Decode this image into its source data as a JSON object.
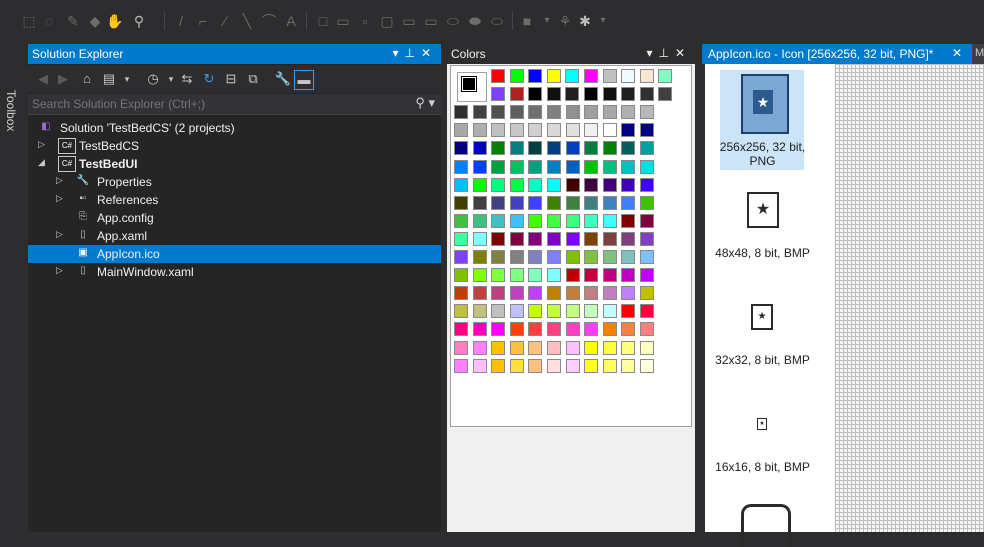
{
  "toolbox": {
    "label": "Toolbox"
  },
  "solution_explorer": {
    "title": "Solution Explorer",
    "search_placeholder": "Search Solution Explorer (Ctrl+;)",
    "items": [
      {
        "label": "Solution 'TestBedCS' (2 projects)"
      },
      {
        "label": "TestBedCS"
      },
      {
        "label": "TestBedUI"
      },
      {
        "label": "Properties"
      },
      {
        "label": "References"
      },
      {
        "label": "App.config"
      },
      {
        "label": "App.xaml"
      },
      {
        "label": "AppIcon.ico"
      },
      {
        "label": "MainWindow.xaml"
      }
    ]
  },
  "colors_panel": {
    "title": "Colors"
  },
  "editor": {
    "tab_title": "AppIcon.ico - Icon [256x256, 32 bit, PNG]*",
    "tab2_label": "M",
    "thumbnails": [
      {
        "label_line1": "256x256, 32 bit,",
        "label_line2": "PNG"
      },
      {
        "label": "48x48, 8 bit, BMP"
      },
      {
        "label": "32x32, 8 bit, BMP"
      },
      {
        "label": "16x16, 8 bit, BMP"
      }
    ]
  },
  "palette": [
    [
      "#ff0000",
      "#00ff00",
      "#0000ff",
      "#ffff00",
      "#00ffff",
      "#ff00ff",
      "#c0c0c0",
      "#f0fbff",
      "#fae6d2",
      "#80ffc0",
      "#0000ff"
    ],
    [
      "#8040ff",
      "#b02020",
      "#000000",
      "#101010",
      "#202020",
      "#000000",
      "#101010",
      "#202020",
      "#303030",
      "#404040",
      "#404040"
    ],
    [
      "#303030",
      "#404040",
      "#505050",
      "#606060",
      "#707070",
      "#808080",
      "#909090",
      "#a0a0a0",
      "#a8a8a8",
      "#b0b0b0",
      "#b8b8b8"
    ],
    [
      "#a8a8a8",
      "#b0b0b0",
      "#c0c0c0",
      "#c8c8c8",
      "#d0d0d0",
      "#d8d8d8",
      "#e0e0e0",
      "#f0f0f0",
      "#ffffff",
      "#000080",
      "#000080"
    ],
    [
      "#000080",
      "#0000c0",
      "#008000",
      "#008080",
      "#004040",
      "#004080",
      "#0040c0",
      "#008040",
      "#008000",
      "#006060",
      "#00a0a0"
    ],
    [
      "#0080ff",
      "#0040ff",
      "#00a040",
      "#00c060",
      "#00a080",
      "#0080c0",
      "#0060c0",
      "#00c000",
      "#00c080",
      "#00c0c0",
      "#00e0e0"
    ],
    [
      "#00c0ff",
      "#00ff00",
      "#00ff80",
      "#00ff40",
      "#00ffc0",
      "#00ffff",
      "#400000",
      "#400040",
      "#400080",
      "#4000c0",
      "#4000ff"
    ],
    [
      "#404000",
      "#404040",
      "#404080",
      "#4040c0",
      "#4040ff",
      "#408000",
      "#408040",
      "#408080",
      "#4080c0",
      "#4080ff",
      "#40c000"
    ],
    [
      "#40c040",
      "#40c080",
      "#40c0c0",
      "#40c0ff",
      "#40ff00",
      "#40ff40",
      "#40ff80",
      "#40ffc0",
      "#40ffff",
      "#800000",
      "#800040"
    ],
    [
      "#40ffa0",
      "#80ffff",
      "#800000",
      "#800040",
      "#800080",
      "#8000c0",
      "#8000ff",
      "#804000",
      "#804040",
      "#804080",
      "#8040c0"
    ],
    [
      "#8040ff",
      "#808000",
      "#808040",
      "#808080",
      "#8080c0",
      "#8080ff",
      "#80c000",
      "#80c040",
      "#80c080",
      "#80c0c0",
      "#80c0ff"
    ],
    [
      "#80c000",
      "#80ff00",
      "#80ff40",
      "#80ff80",
      "#80ffc0",
      "#80ffff",
      "#c00000",
      "#c00040",
      "#c00080",
      "#c000c0",
      "#c000ff"
    ],
    [
      "#c04000",
      "#c04040",
      "#c04080",
      "#c040c0",
      "#c040ff",
      "#c08000",
      "#c08040",
      "#c08080",
      "#c080c0",
      "#c080ff",
      "#c0c000"
    ],
    [
      "#c0c040",
      "#c0c080",
      "#c0c0c0",
      "#c0c0ff",
      "#c0ff00",
      "#c0ff40",
      "#c0ff80",
      "#c0ffc0",
      "#c0ffff",
      "#ff0000",
      "#ff0040"
    ],
    [
      "#ff0080",
      "#ff00c0",
      "#ff00ff",
      "#ff4000",
      "#ff4040",
      "#ff4080",
      "#ff40c0",
      "#ff40ff",
      "#ff8000",
      "#ff8040",
      "#ff8080"
    ],
    [
      "#ff80c0",
      "#ff80ff",
      "#ffc000",
      "#ffc040",
      "#ffc080",
      "#ffc0c0",
      "#ffc0ff",
      "#ffff00",
      "#ffff40",
      "#ffff80",
      "#ffffc0"
    ],
    [
      "#ff80ff",
      "#ffc0ff",
      "#ffc000",
      "#ffe040",
      "#ffc080",
      "#ffe0e0",
      "#ffd0ff",
      "#ffff20",
      "#ffff60",
      "#ffffa0",
      "#ffffe0"
    ]
  ]
}
